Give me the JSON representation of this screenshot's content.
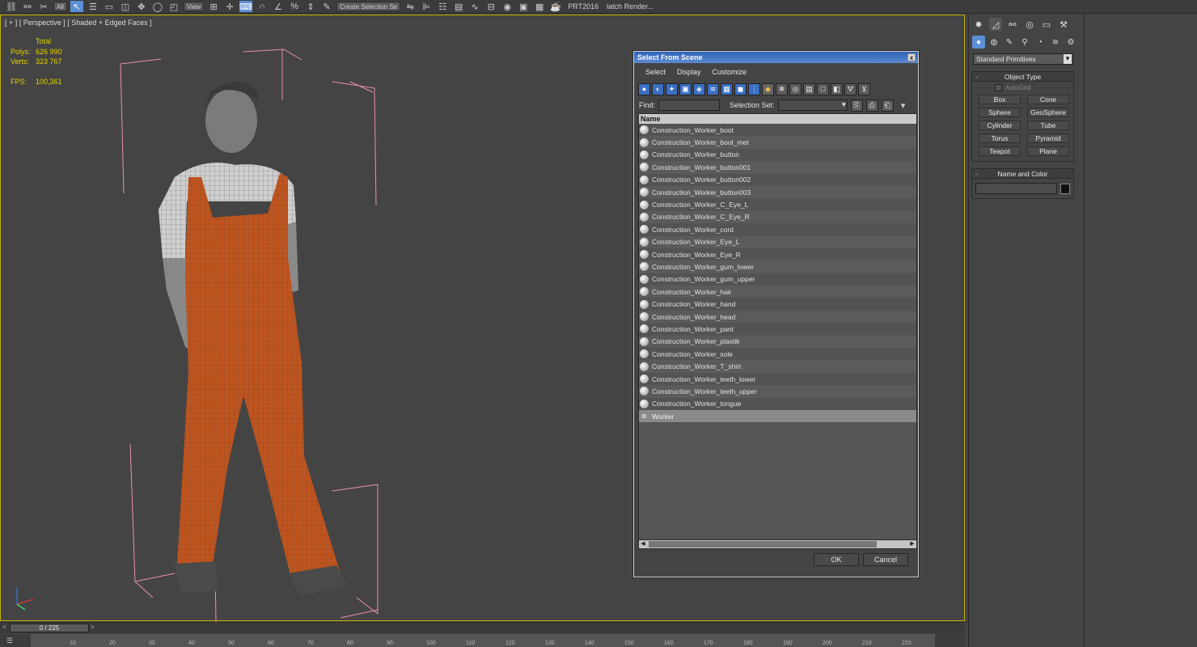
{
  "toolbar": {
    "selection_filter": "All",
    "ref_coord": "View",
    "named_sel": "Create Selection Se",
    "prt_label": "PRT2016",
    "batch_render_label": "latch Render..."
  },
  "viewport": {
    "label": "[ + ] [ Perspective ] [ Shaded + Edged Faces ]",
    "stats": {
      "total_label": "Total",
      "polys_label": "Polys:",
      "polys_value": "626 990",
      "verts_label": "Verts:",
      "verts_value": "323 767",
      "fps_label": "FPS:",
      "fps_value": "100,361"
    }
  },
  "dialog": {
    "title": "Select From Scene",
    "close": "x",
    "menu": [
      "Select",
      "Display",
      "Customize"
    ],
    "find_label": "Find:",
    "find_value": "",
    "selection_set_label": "Selection Set:",
    "selection_set_value": "",
    "column_header": "Name",
    "rows": [
      "Construction_Worker_boot",
      "Construction_Worker_boot_met",
      "Construction_Worker_button",
      "Construction_Worker_button001",
      "Construction_Worker_button002",
      "Construction_Worker_button003",
      "Construction_Worker_C_Eye_L",
      "Construction_Worker_C_Eye_R",
      "Construction_Worker_cord",
      "Construction_Worker_Eye_L",
      "Construction_Worker_Eye_R",
      "Construction_Worker_gum_lower",
      "Construction_Worker_gum_upper",
      "Construction_Worker_hair",
      "Construction_Worker_hand",
      "Construction_Worker_head",
      "Construction_Worker_pant",
      "Construction_Worker_plastik",
      "Construction_Worker_sole",
      "Construction_Worker_T_shirt",
      "Construction_Worker_teeth_lower",
      "Construction_Worker_teeth_upper",
      "Construction_Worker_tongue",
      "Worker"
    ],
    "selected_row": "Worker",
    "ok_label": "OK",
    "cancel_label": "Cancel"
  },
  "command_panel": {
    "category": "Standard Primitives",
    "object_type_title": "Object Type",
    "autogrid_label": "AutoGrid",
    "buttons": [
      "Box",
      "Cone",
      "Sphere",
      "GeoSphere",
      "Cylinder",
      "Tube",
      "Torus",
      "Pyramid",
      "Teapot",
      "Plane"
    ],
    "name_color_title": "Name and Color",
    "name_value": "",
    "rollout_minus": "-",
    "swatch_color": "#111111"
  },
  "timeline": {
    "position": "0 / 225",
    "ticks": [
      "10",
      "20",
      "30",
      "40",
      "50",
      "60",
      "70",
      "80",
      "90",
      "100",
      "110",
      "120",
      "130",
      "140",
      "150",
      "160",
      "170",
      "180",
      "190",
      "200",
      "210",
      "220"
    ]
  },
  "colors": {
    "accent": "#5b8fd6",
    "stats": "#e6d100",
    "bbox": "#e88fb0",
    "overalls": "#c0541e"
  }
}
